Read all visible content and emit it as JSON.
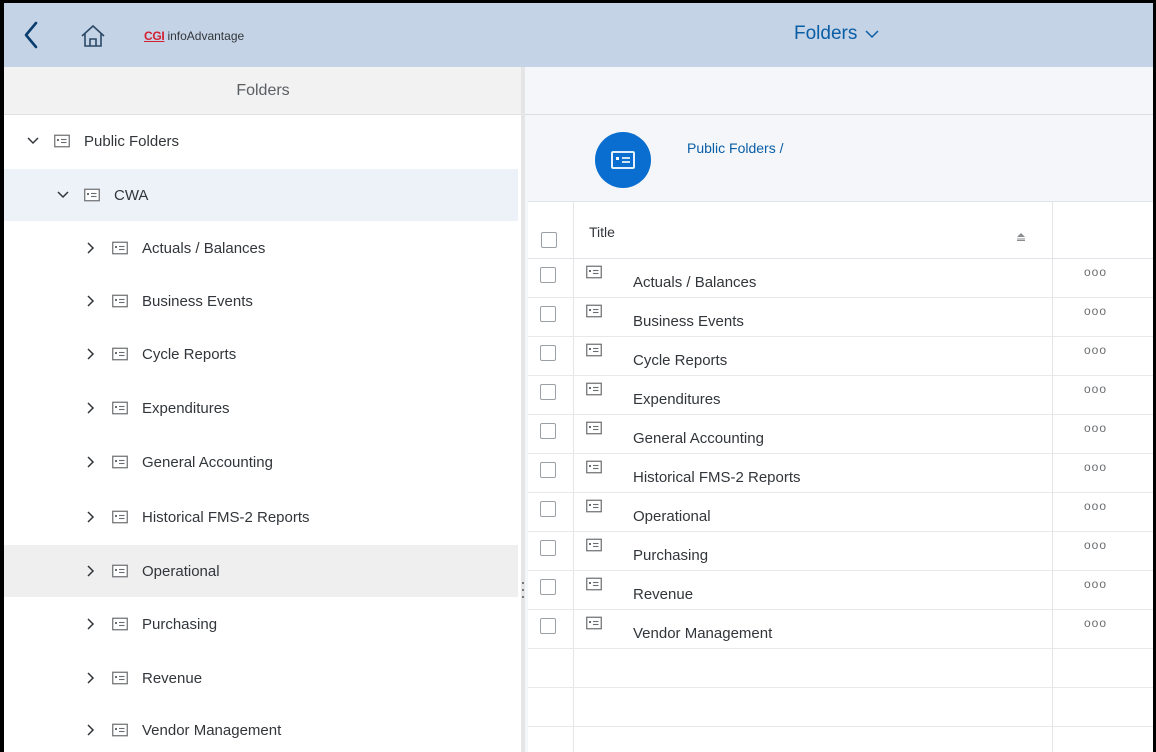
{
  "shell": {
    "logo_brand": "CGI",
    "logo_product": "infoAdvantage",
    "title": "Folders",
    "icons": {
      "back": "back-chevron-icon",
      "home": "home-icon",
      "title_menu": "chevron-down-icon"
    },
    "colors": {
      "header_bg": "#c4d3e6",
      "title": "#0a5ea6",
      "brand_red": "#d41f31"
    }
  },
  "left_panel": {
    "header": "Folders",
    "tree": [
      {
        "label": "Public Folders",
        "expanded": true,
        "level": 0
      },
      {
        "label": "CWA",
        "expanded": true,
        "level": 1,
        "selected": true
      },
      {
        "label": "Actuals / Balances",
        "expanded": false,
        "level": 2
      },
      {
        "label": "Business Events",
        "expanded": false,
        "level": 2
      },
      {
        "label": "Cycle Reports",
        "expanded": false,
        "level": 2
      },
      {
        "label": "Expenditures",
        "expanded": false,
        "level": 2
      },
      {
        "label": "General Accounting",
        "expanded": false,
        "level": 2
      },
      {
        "label": "Historical FMS-2 Reports",
        "expanded": false,
        "level": 2
      },
      {
        "label": "Operational",
        "expanded": false,
        "level": 2,
        "hover": true
      },
      {
        "label": "Purchasing",
        "expanded": false,
        "level": 2
      },
      {
        "label": "Revenue",
        "expanded": false,
        "level": 2
      },
      {
        "label": "Vendor Management",
        "expanded": false,
        "level": 2
      }
    ]
  },
  "right_panel": {
    "breadcrumb": "Public Folders /",
    "avatar_icon": "folder-icon",
    "table": {
      "columns": [
        "Title"
      ],
      "rows": [
        "Actuals / Balances",
        "Business Events",
        "Cycle Reports",
        "Expenditures",
        "General Accounting",
        "Historical FMS-2 Reports",
        "Operational",
        "Purchasing",
        "Revenue",
        "Vendor Management"
      ],
      "more_label": "ooo"
    }
  }
}
